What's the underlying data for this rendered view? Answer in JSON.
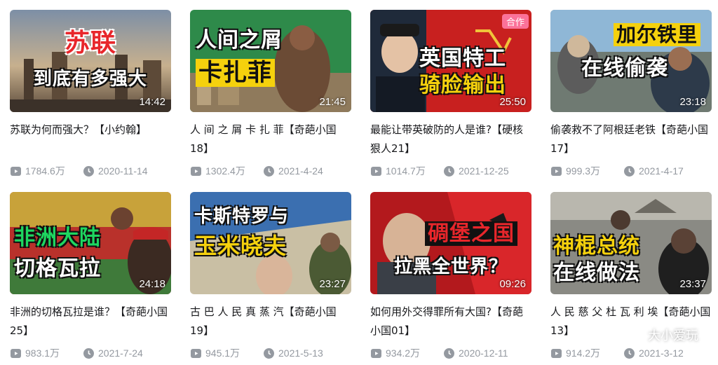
{
  "videos": [
    {
      "cap1": "苏联",
      "cap2": "到底有多强大",
      "duration": "14:42",
      "title": "苏联为何而强大？【小约翰】",
      "views": "1784.6万",
      "date": "2020-11-14"
    },
    {
      "cap1": "人间之屑",
      "cap2": "卡扎菲",
      "duration": "21:45",
      "title": "人 间 之 屑 卡 扎 菲【奇葩小国18】",
      "views": "1302.4万",
      "date": "2021-4-24"
    },
    {
      "cap1": "英国特工",
      "cap2": "骑脸输出",
      "duration": "25:50",
      "badge": "合作",
      "title": "最能让带英破防的人是谁?【硬核狠人21】",
      "views": "1014.7万",
      "date": "2021-12-25"
    },
    {
      "cap1": "加尔铁里",
      "cap2": "在线偷袭",
      "duration": "23:18",
      "title": "偷袭救不了阿根廷老铁【奇葩小国17】",
      "views": "999.3万",
      "date": "2021-4-17"
    },
    {
      "cap1": "非洲大陆",
      "cap2": "切格瓦拉",
      "duration": "24:18",
      "title": "非洲的切格瓦拉是谁？【奇葩小国25】",
      "views": "983.1万",
      "date": "2021-7-24"
    },
    {
      "cap1": "卡斯特罗与",
      "cap2": "玉米晓夫",
      "duration": "23:27",
      "title": "古 巴 人 民 真 蒸 汽【奇葩小国19】",
      "views": "945.1万",
      "date": "2021-5-13"
    },
    {
      "cap1": "碉堡之国",
      "cap2": "拉黑全世界？",
      "duration": "09:26",
      "title": "如何用外交得罪所有大国?【奇葩小国01】",
      "views": "934.2万",
      "date": "2020-12-11"
    },
    {
      "cap1": "神棍总统",
      "cap2": "在线做法",
      "duration": "23:37",
      "title": "人 民 慈 父 杜 瓦 利 埃【奇葩小国13】",
      "views": "914.2万",
      "date": "2021-3-12"
    }
  ],
  "watermark": {
    "text": "大小爱玩"
  },
  "icons": {
    "views": "play-count-icon",
    "date": "clock-icon",
    "watermark": "wechat-icon"
  },
  "colors": {
    "badge": "#fb7299",
    "meta_text": "#9499a0",
    "caption_red": "#e8262b",
    "caption_yellow": "#f5d10d"
  }
}
